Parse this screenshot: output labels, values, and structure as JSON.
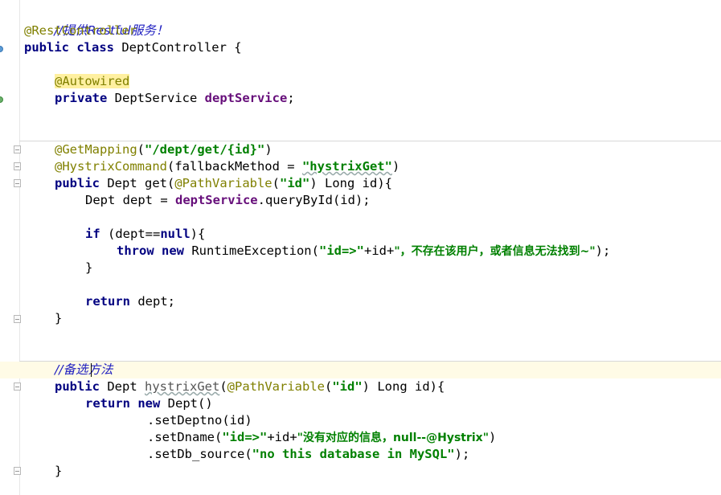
{
  "editor": {
    "language": "Java",
    "lines": {
      "l1": "//提供Restful服务！",
      "l2": "@RestController",
      "l3a": "public class",
      "l3b": " DeptController {",
      "l4": "@Autowired",
      "l5a": "private",
      "l5b": " DeptService ",
      "l5c": "deptService",
      "l5d": ";",
      "l6a": "@GetMapping",
      "l6b": "(",
      "l6c": "\"/dept/get/{id}\"",
      "l6d": ")",
      "l7a": "@HystrixCommand",
      "l7b": "(fallbackMethod = ",
      "l7c": "\"hystrixGet\"",
      "l7d": ")",
      "l8a": "public",
      "l8b": " Dept get(",
      "l8c": "@PathVariable",
      "l8d": "(",
      "l8e": "\"id\"",
      "l8f": ") Long id){",
      "l9a": "Dept dept = ",
      "l9b": "deptService",
      "l9c": ".queryById(id);",
      "l10a": "if",
      "l10b": " (dept==",
      "l10c": "null",
      "l10d": "){",
      "l11a": "throw new",
      "l11b": " RuntimeException(",
      "l11c": "\"id=>\"",
      "l11d": "+id+",
      "l11e": "\"，不存在该用户，或者信息无法找到~\"",
      "l11f": ");",
      "l12": "}",
      "l13a": "return",
      "l13b": " dept;",
      "l14": "}",
      "l15": "//备选方法",
      "l16a": "public",
      "l16b": " Dept ",
      "l16c": "hystrixGet",
      "l16d": "(",
      "l16e": "@PathVariable",
      "l16f": "(",
      "l16g": "\"id\"",
      "l16h": ") Long id){",
      "l17a": "return new",
      "l17b": " Dept()",
      "l18": ".setDeptno(id)",
      "l19a": ".setDname(",
      "l19b": "\"id=>\"",
      "l19c": "+id+",
      "l19d": "\"没有对应的信息，null--@Hystrix\"",
      "l19e": ")",
      "l20a": ".setDb_source(",
      "l20b": "\"no this database in MySQL\"",
      "l20c": ");",
      "l21": "}"
    }
  },
  "colors": {
    "comment": "#2020c0",
    "keyword": "#000080",
    "annotation": "#808000",
    "string": "#008000",
    "field": "#660e7a",
    "current_line": "#fffbe6"
  }
}
